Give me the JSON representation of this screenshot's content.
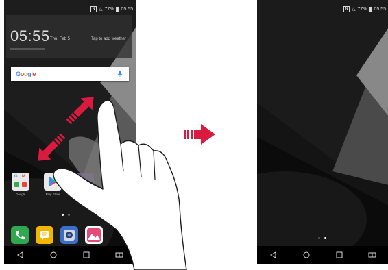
{
  "status": {
    "battery": "77%",
    "time": "05:55",
    "nfc": "N"
  },
  "clock": {
    "time": "05:55",
    "date": "Thu, Feb 5",
    "weather": "Tap to add weather"
  },
  "google": {
    "logo": "Google"
  },
  "apps": [
    {
      "name": "Google"
    },
    {
      "name": "Play Store"
    }
  ],
  "colors": {
    "phone_app": "#2fa84f",
    "messages_app": "#f4b400",
    "camera_app": "#3d6ec5",
    "gallery_app": "#e64a77",
    "arrow": "#d81b3f",
    "finger_overlay": "#7a7a7a"
  }
}
